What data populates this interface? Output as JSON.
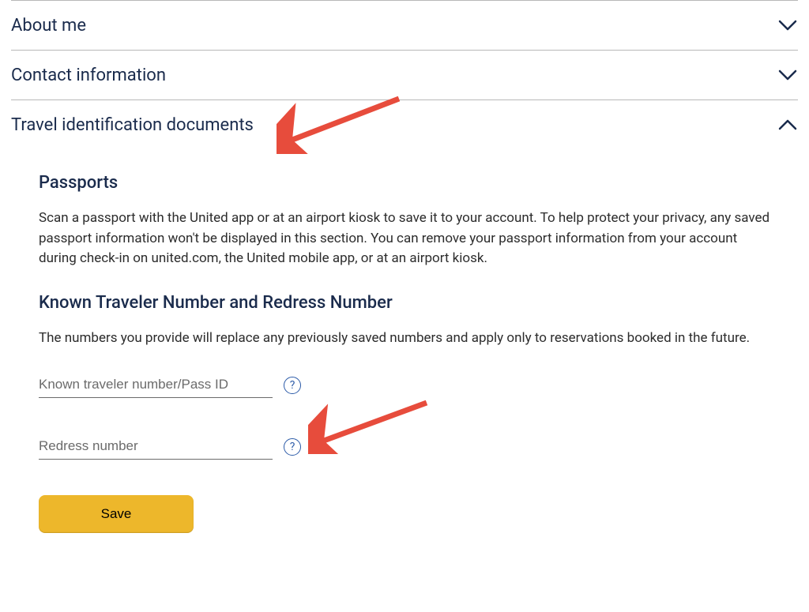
{
  "accordion": {
    "items": [
      {
        "title": "About me",
        "expanded": false
      },
      {
        "title": "Contact information",
        "expanded": false
      },
      {
        "title": "Travel identification documents",
        "expanded": true
      }
    ]
  },
  "content": {
    "passports_heading": "Passports",
    "passports_text": "Scan a passport with the United app or at an airport kiosk to save it to your account. To help protect your privacy, any saved passport information won't be displayed in this section. You can remove your passport information from your account during check-in on united.com, the United mobile app, or at an airport kiosk.",
    "ktn_heading": "Known Traveler Number and Redress Number",
    "ktn_text": "The numbers you provide will replace any previously saved numbers and apply only to reservations booked in the future.",
    "ktn_placeholder": "Known traveler number/Pass ID",
    "ktn_value": "",
    "redress_placeholder": "Redress number",
    "redress_value": "",
    "help_glyph": "?",
    "save_label": "Save"
  },
  "colors": {
    "accent_navy": "#1a2b4c",
    "accent_blue": "#2b5aa8",
    "button_yellow": "#edb72b",
    "annotation_red": "#e74c3c"
  }
}
